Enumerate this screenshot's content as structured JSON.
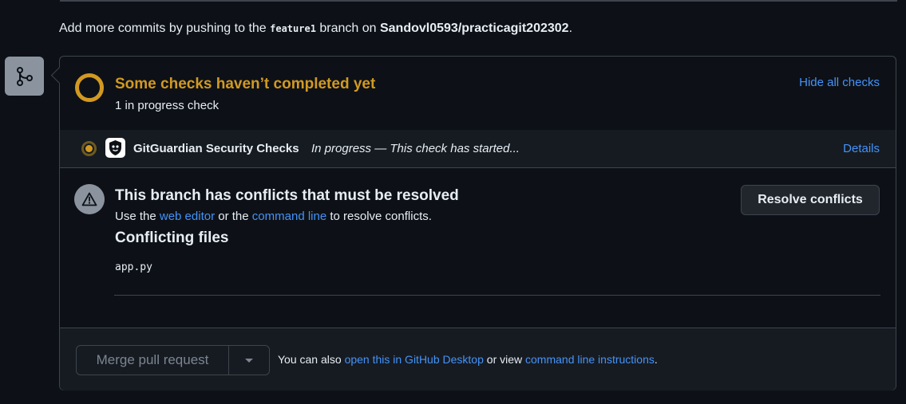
{
  "info": {
    "prefix": "Add more commits by pushing to the ",
    "branch": "feature1",
    "middle": " branch on ",
    "repo": "Sandovl0593/practicagit202302",
    "suffix": "."
  },
  "icons": {
    "merge": "git-merge-icon",
    "pending": "pending-ring-icon",
    "in_progress": "in-progress-dot-icon",
    "gitguardian": "gitguardian-logo",
    "alert": "alert-triangle-icon",
    "dropdown": "caret-down-icon"
  },
  "colors": {
    "background": "#0d1117",
    "panel": "#161b22",
    "border": "#3d444d",
    "warning": "#d29922",
    "link": "#4493f8",
    "muted": "#7d8590"
  },
  "checks": {
    "title": "Some checks haven’t completed yet",
    "subtitle": "1 in progress check",
    "hide_all_label": "Hide all checks",
    "items": [
      {
        "name": "GitGuardian Security Checks",
        "status": "In progress — This check has started...",
        "details_label": "Details"
      }
    ]
  },
  "conflicts": {
    "title": "This branch has conflicts that must be resolved",
    "desc_prefix": "Use the ",
    "web_editor_label": "web editor",
    "desc_middle": " or the ",
    "command_line_label": "command line",
    "desc_suffix": " to resolve conflicts.",
    "files_title": "Conflicting files",
    "files": [
      "app.py"
    ],
    "resolve_button_label": "Resolve conflicts"
  },
  "merge": {
    "button_label": "Merge pull request",
    "note_prefix": "You can also ",
    "desktop_link_label": "open this in GitHub Desktop",
    "note_middle": " or view ",
    "cli_link_label": "command line instructions",
    "note_suffix": "."
  }
}
